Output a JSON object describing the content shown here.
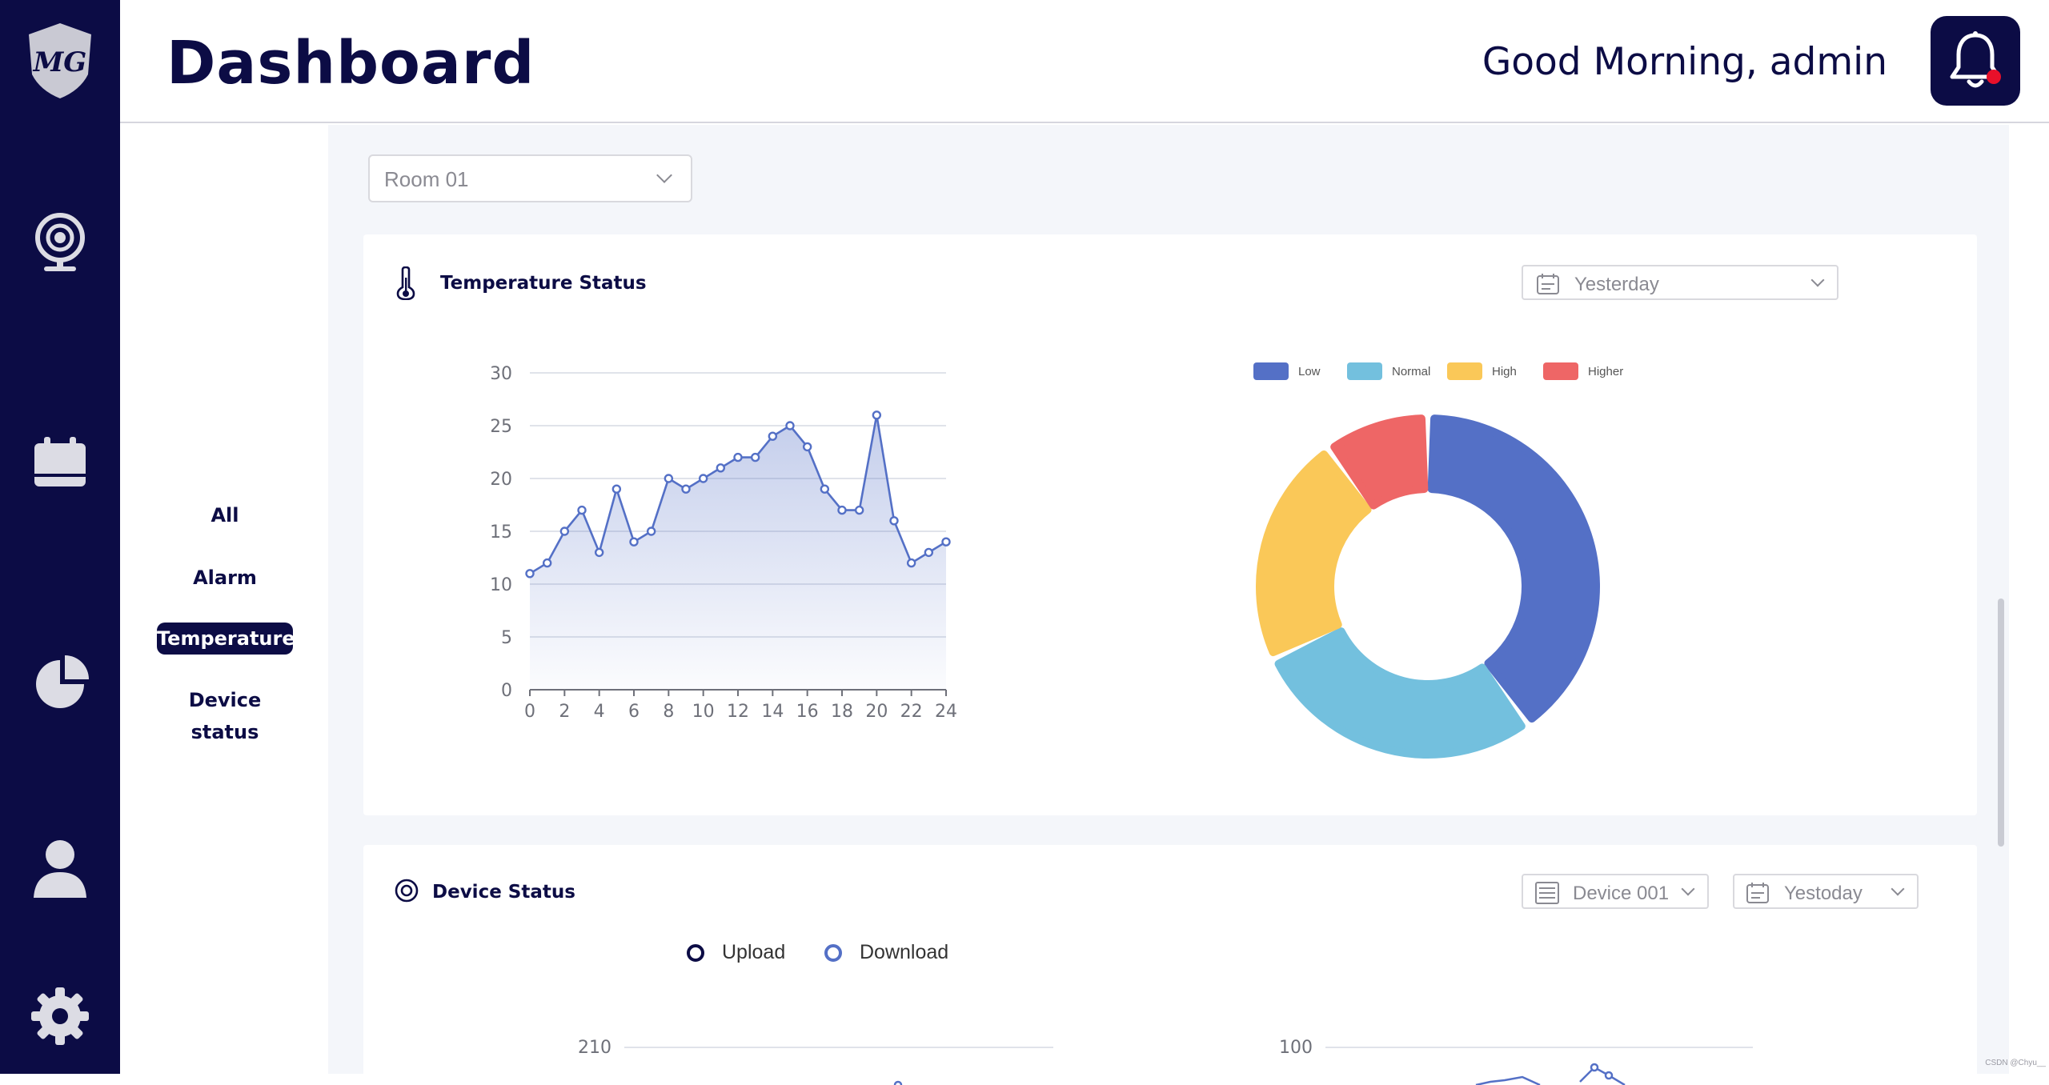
{
  "header": {
    "title": "Dashboard",
    "greeting": "Good Morning, admin"
  },
  "sidebar": {
    "logo_text": "MG",
    "icons": [
      "webcam-icon",
      "calendar-icon",
      "pie-chart-icon",
      "user-icon",
      "gear-icon"
    ]
  },
  "subnav": {
    "items": [
      {
        "label": "All",
        "active": false
      },
      {
        "label": "Alarm",
        "active": false
      },
      {
        "label": "Temperature",
        "active": true
      },
      {
        "label": "Device status",
        "active": false
      }
    ]
  },
  "room_select": {
    "value": "Room 01"
  },
  "temperature": {
    "title": "Temperature Status",
    "date_select": "Yesterday"
  },
  "device": {
    "title": "Device Status",
    "device_select": "Device 001",
    "date_select": "Yestoday",
    "legend": [
      "Upload",
      "Download"
    ],
    "left_chart_top_tick": "210",
    "right_chart_top_tick": "100"
  },
  "colors": {
    "navy": "#0c0c45",
    "low": "#5470c6",
    "normal": "#73c0de",
    "high": "#fac858",
    "higher": "#ee6666"
  },
  "chart_data": [
    {
      "type": "area",
      "x": [
        0,
        1,
        2,
        3,
        4,
        5,
        6,
        7,
        8,
        9,
        10,
        11,
        12,
        13,
        14,
        15,
        16,
        17,
        18,
        19,
        20,
        21,
        22,
        23,
        24
      ],
      "values": [
        11,
        12,
        15,
        17,
        13,
        19,
        14,
        15,
        20,
        19,
        20,
        21,
        22,
        22,
        24,
        25,
        23,
        19,
        17,
        17,
        26,
        16,
        12,
        13,
        14
      ],
      "x_ticks": [
        "0",
        "2",
        "4",
        "6",
        "8",
        "10",
        "12",
        "14",
        "16",
        "18",
        "20",
        "22",
        "24"
      ],
      "y_ticks": [
        "0",
        "5",
        "10",
        "15",
        "20",
        "25",
        "30"
      ],
      "ylim": [
        0,
        30
      ],
      "xlim": [
        0,
        24
      ]
    },
    {
      "type": "pie",
      "donut": true,
      "labels": [
        "Low",
        "Normal",
        "High",
        "Higher"
      ],
      "values": [
        40,
        28,
        22,
        10
      ],
      "legend_position": "top"
    }
  ],
  "watermark": "CSDN @Chyu__"
}
